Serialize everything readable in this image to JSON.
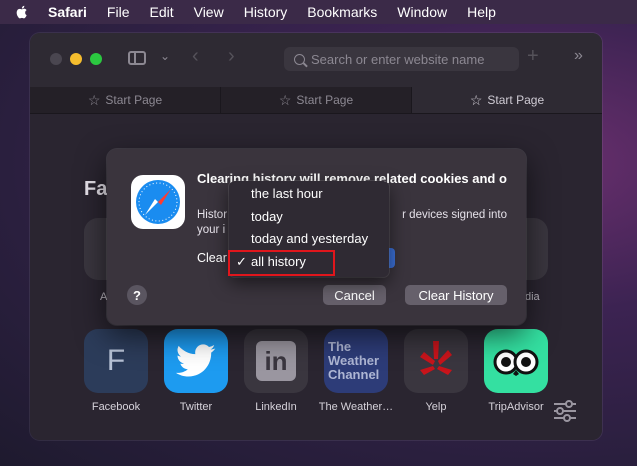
{
  "menubar": {
    "items": [
      "Safari",
      "File",
      "Edit",
      "View",
      "History",
      "Bookmarks",
      "Window",
      "Help"
    ]
  },
  "toolbar": {
    "address_placeholder": "Search or enter website name"
  },
  "tabs": [
    {
      "label": "Start Page"
    },
    {
      "label": "Start Page"
    },
    {
      "label": "Start Page"
    }
  ],
  "page": {
    "favorites_heading_partial": "Fa",
    "partial_labels": [
      "A",
      "dia"
    ],
    "favorites": [
      {
        "label": "Facebook",
        "glyph": "F",
        "color": "#2c3c5a"
      },
      {
        "label": "Twitter",
        "color": "#1d9bf0"
      },
      {
        "label": "LinkedIn",
        "glyph": "in",
        "color": "#3a363f"
      },
      {
        "label": "The Weather…",
        "glyph_lines": [
          "The",
          "Weather",
          "Channel"
        ],
        "color": "#2d3c78"
      },
      {
        "label": "Yelp",
        "color": "#3a363f"
      },
      {
        "label": "TripAdvisor",
        "color": "#34e0a1"
      }
    ]
  },
  "dialog": {
    "title": "Clearing history will remove related cookies and o",
    "title_line2_start": "and o",
    "body_line1": "Histor",
    "body_line1_end": "r devices signed into",
    "body_line2": "your i",
    "clear_label": "Clear",
    "cancel_label": "Cancel",
    "clear_history_label": "Clear History",
    "help_label": "?"
  },
  "dropdown": {
    "options": [
      {
        "label": "the last hour",
        "checked": false
      },
      {
        "label": "today",
        "checked": false
      },
      {
        "label": "today and yesterday",
        "checked": false
      },
      {
        "label": "all history",
        "checked": true
      }
    ],
    "checkmark": "✓"
  },
  "colors": {
    "highlight": "#e0161c",
    "accent": "#3b6fd6"
  }
}
